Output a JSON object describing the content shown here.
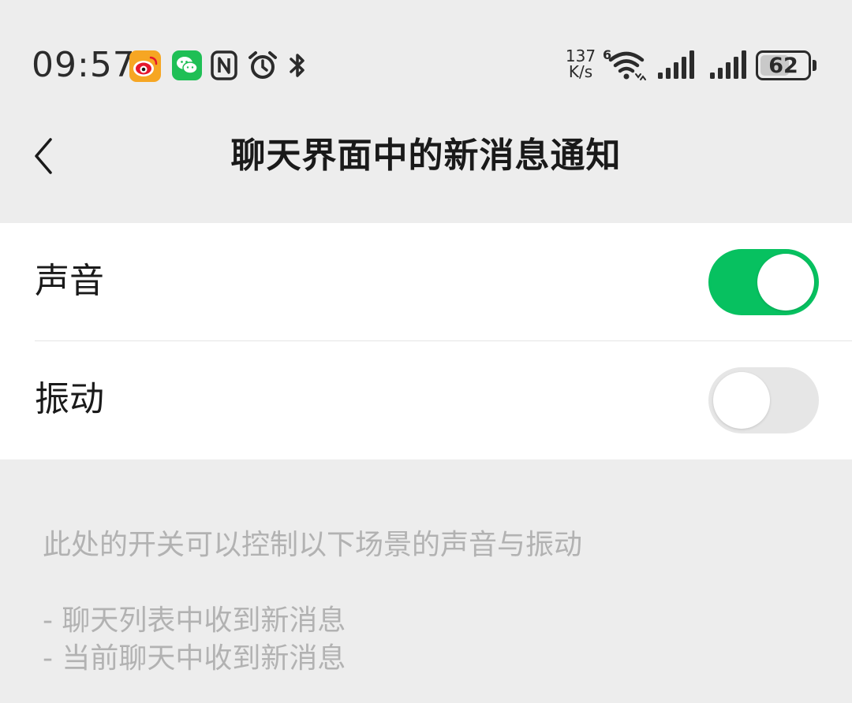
{
  "status_bar": {
    "time": "09:57",
    "net_speed_value": "137",
    "net_speed_unit": "K/s",
    "wifi_badge": "6",
    "battery_level": "62",
    "battery_fraction": 0.62,
    "icons": [
      "weibo-icon",
      "wechat-icon",
      "nfc-icon",
      "alarm-icon",
      "bluetooth-icon",
      "wifi-icon",
      "signal-icon",
      "signal-icon",
      "battery-icon"
    ]
  },
  "header": {
    "title": "聊天界面中的新消息通知",
    "back_icon": "chevron-left-icon"
  },
  "settings": {
    "items": [
      {
        "label": "声音",
        "enabled": true
      },
      {
        "label": "振动",
        "enabled": false
      }
    ]
  },
  "description": {
    "intro": "此处的开关可以控制以下场景的声音与振动",
    "lines": [
      "- 聊天列表中收到新消息",
      "- 当前聊天中收到新消息"
    ]
  },
  "colors": {
    "background": "#ededed",
    "accent_green": "#07c160",
    "toggle_off": "#e6e6e6",
    "hint_text": "#b2b2b2"
  }
}
